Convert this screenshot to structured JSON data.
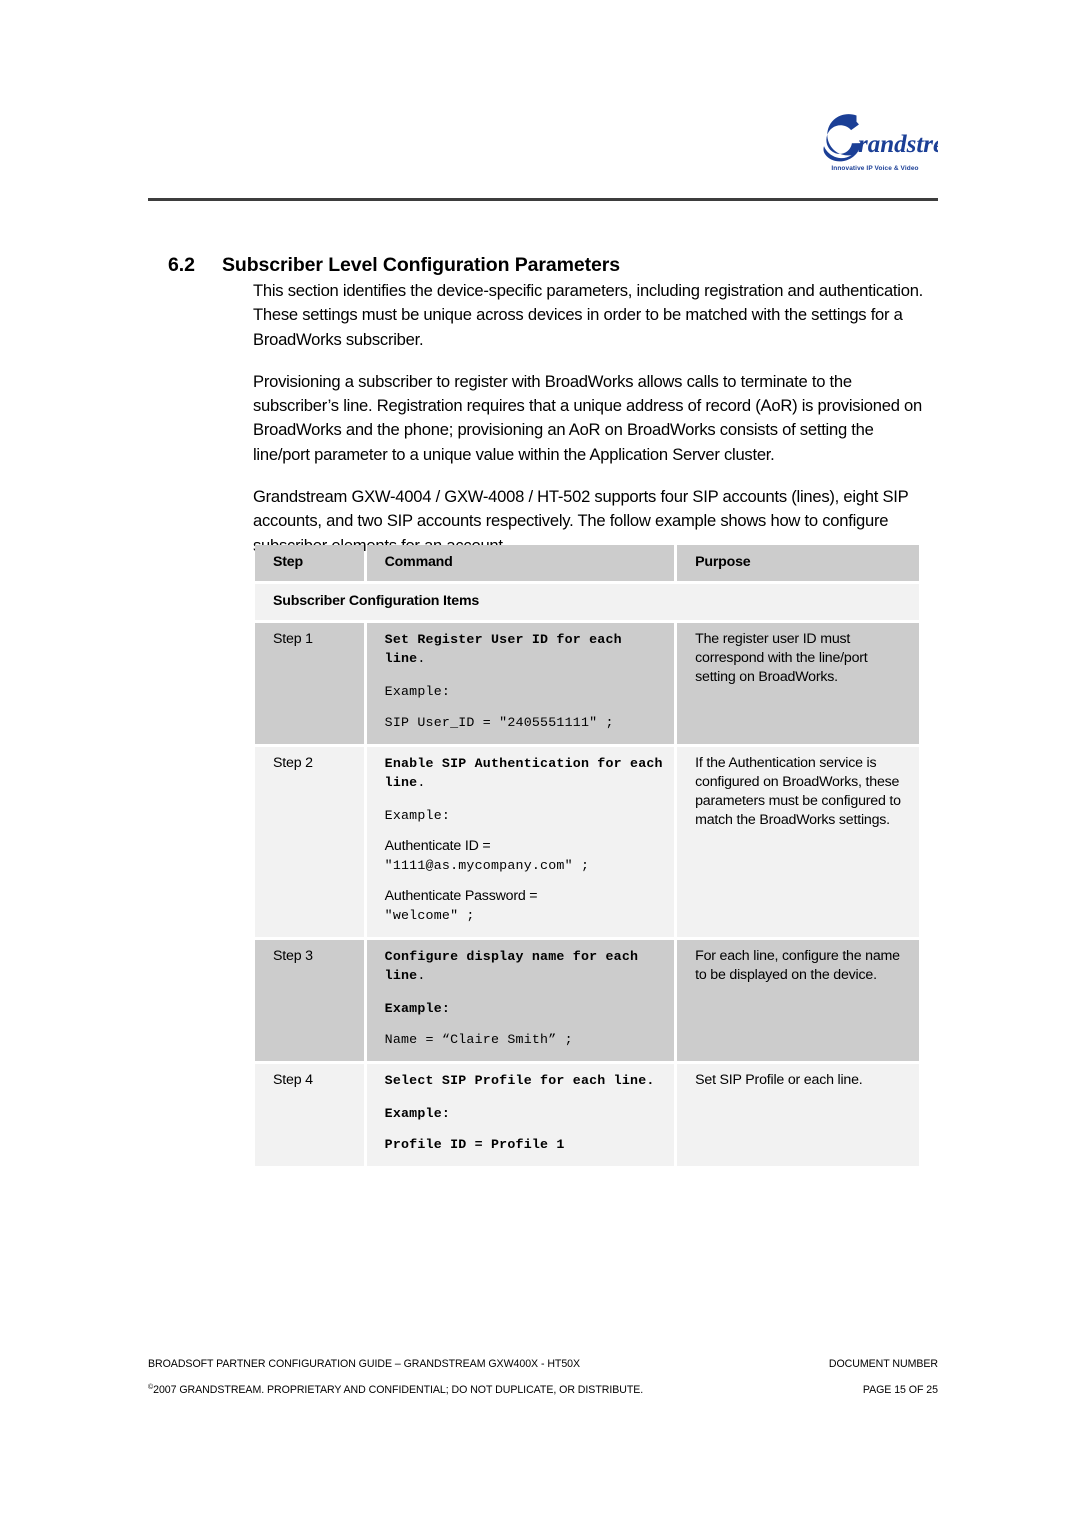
{
  "header": {
    "logo": {
      "name": "Grandstream",
      "wordmark": "randstream",
      "tagline": "Innovative IP Voice & Video",
      "color": "#1b3f96"
    }
  },
  "section": {
    "number": "6.2",
    "title": "Subscriber Level Configuration Parameters"
  },
  "paragraphs": [
    "This section identifies the device-specific parameters, including registration and authentication.  These settings must be unique across devices in order to be matched with the settings for a BroadWorks subscriber.",
    "Provisioning a subscriber to register with BroadWorks allows calls to terminate to the subscriber’s line.  Registration requires that a unique address of record (AoR) is provisioned on BroadWorks and the phone; provisioning an AoR on BroadWorks consists of setting the line/port parameter to a unique value within the Application Server cluster.",
    "Grandstream GXW-4004 / GXW-4008 / HT-502 supports four SIP accounts (lines), eight SIP accounts, and two SIP accounts respectively. The follow example shows how to configure subscriber elements for an account."
  ],
  "table": {
    "columns": [
      "Step",
      "Command",
      "Purpose"
    ],
    "subheader": "Subscriber Configuration Items",
    "rows": [
      {
        "step": "Step 1",
        "command_bold": "Set Register User ID for each line",
        "command_bold_end": ".",
        "example_label": "Example:",
        "example_label_bold": false,
        "example_lines": [
          {
            "text": "SIP User_ID = \"2405551111\" ;",
            "style": "mono"
          }
        ],
        "purpose": "The register user ID must correspond with the line/port setting on BroadWorks."
      },
      {
        "step": "Step 2",
        "command_bold": "Enable SIP Authentication for each line",
        "command_bold_end": ".",
        "example_label": "Example:",
        "example_label_bold": false,
        "example_lines": [
          {
            "text": "Authenticate ID =",
            "style": "sans"
          },
          {
            "text": "\"1111@as.mycompany.com\" ;",
            "style": "mono"
          },
          {
            "text": "Authenticate Password =",
            "style": "sans"
          },
          {
            "text": "\"welcome\" ;",
            "style": "mono"
          }
        ],
        "purpose": "If the Authentication service is configured on BroadWorks, these parameters must be configured to match the BroadWorks settings."
      },
      {
        "step": "Step 3",
        "command_bold": "Configure display name for each line",
        "command_bold_end": ".",
        "example_label": "Example:",
        "example_label_bold": true,
        "example_lines": [
          {
            "text": "Name = “Claire Smith” ;",
            "style": "mono"
          }
        ],
        "purpose": "For each line, configure the name to be displayed on the device."
      },
      {
        "step": "Step 4",
        "command_bold": "Select SIP Profile for each line.",
        "command_bold_end": "",
        "example_label": "Example:",
        "example_label_bold": true,
        "example_lines": [
          {
            "text": "Profile ID = Profile 1",
            "style": "mono-b"
          }
        ],
        "purpose": "Set SIP Profile or each line."
      }
    ]
  },
  "footer": {
    "line1_left": "BROADSOFT PARTNER CONFIGURATION GUIDE – GRANDSTREAM GXW400X - HT50X",
    "line1_right": "DOCUMENT NUMBER",
    "copyright_mark": "©",
    "line2_left": "2007 GRANDSTREAM.  PROPRIETARY AND CONFIDENTIAL; DO NOT DUPLICATE, OR DISTRIBUTE.",
    "line2_right": "PAGE 15 OF 25"
  }
}
